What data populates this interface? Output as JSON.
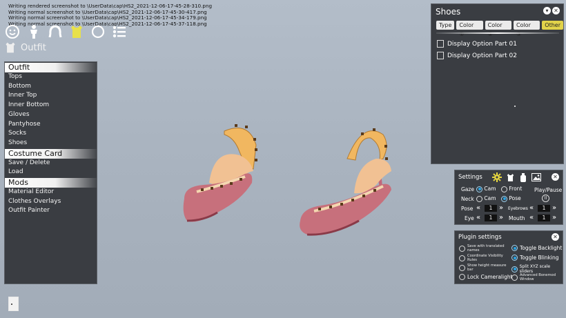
{
  "log_lines": [
    "Writing rendered screenshot to \\UserData\\cap\\HS2_2021-12-06-17-45-28-310.png",
    "Writing normal screenshot to \\UserData\\cap\\HS2_2021-12-06-17-45-30-417.png",
    "Writing normal screenshot to \\UserData\\cap\\HS2_2021-12-06-17-45-34-179.png",
    "Writing normal screenshot to \\UserData\\cap\\HS2_2021-12-06-17-45-37-118.png"
  ],
  "toolbar": {
    "icons": [
      "face-icon",
      "body-icon",
      "hair-icon",
      "outfit-icon",
      "accessory-icon",
      "list-icon"
    ]
  },
  "outfit_header": {
    "label": "Outfit"
  },
  "left_panel": {
    "sections": [
      {
        "header": "Outfit",
        "items": [
          "Tops",
          "Bottom",
          "Inner Top",
          "Inner Bottom",
          "Gloves",
          "Pantyhose",
          "Socks",
          "Shoes"
        ]
      },
      {
        "header": "Costume Card",
        "items": [
          "Save / Delete",
          "Load"
        ]
      },
      {
        "header": "Mods",
        "items": [
          "Material Editor",
          "Clothes Overlays",
          "Outfit Painter"
        ]
      }
    ]
  },
  "shoes_panel": {
    "title": "Shoes",
    "tabs": [
      "Type",
      "Color ①",
      "Color ②",
      "Color ③",
      "Other"
    ],
    "selected_tab": "Other",
    "options": [
      "Display Option Part 01",
      "Display Option Part 02"
    ]
  },
  "settings_panel": {
    "title": "Settings",
    "gaze_label": "Gaze",
    "cam_label": "Cam",
    "front_label": "Front",
    "neck_label": "Neck",
    "pose_label": "Pose",
    "play_pause_label": "Play/Pause",
    "pose_value": "1",
    "eyebrows_label": "Eyebrows",
    "eyebrows_value": "1",
    "eye_label": "Eye",
    "eye_value": "1",
    "mouth_label": "Mouth",
    "mouth_value": "1"
  },
  "plugin_panel": {
    "title": "Plugin settings",
    "left_options": [
      "Save with translated names",
      "Coordinate Visibility Rules",
      "Show height measure bar",
      "Lock Cameralight"
    ],
    "right_options": [
      "Toggle Backlight",
      "Toggle Blinking",
      "Split XYZ scale sliders",
      "Advanced Bonemod Window"
    ],
    "right_checked": [
      true,
      true,
      true,
      false
    ]
  },
  "colors": {
    "panel_bg": "#3a3d42",
    "accent_blue": "#2aa3e3",
    "tab_selected": "#e2d34a",
    "shoe_body": "#c46b7a",
    "shoe_strap": "#f1b760"
  }
}
